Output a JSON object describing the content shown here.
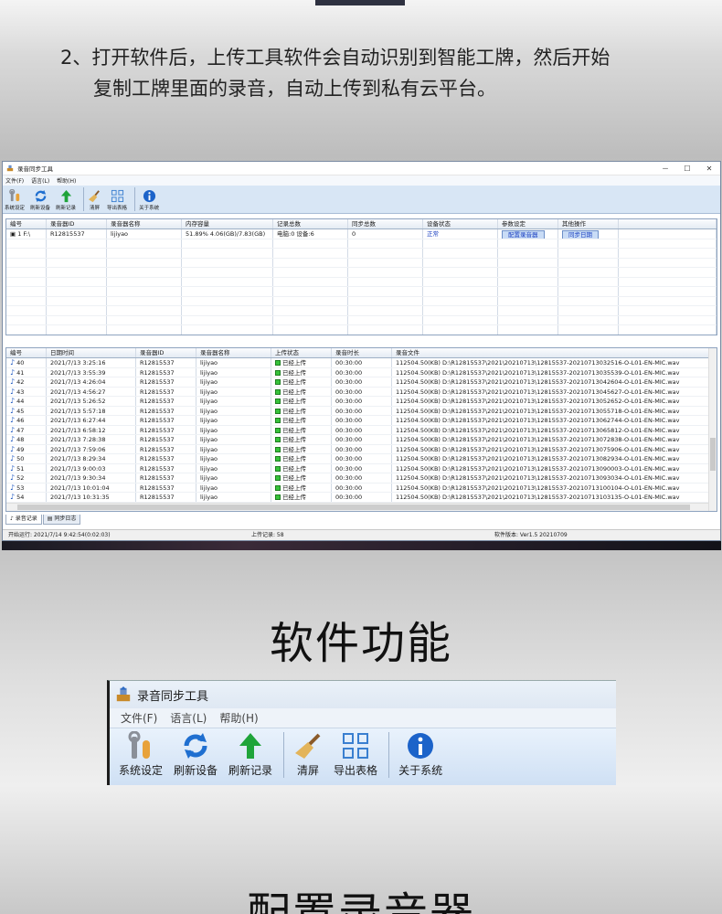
{
  "intro": {
    "line1": "2、打开软件后，上传工具软件会自动识别到智能工牌，然后开始",
    "line2": "复制工牌里面的录音，自动上传到私有云平台。"
  },
  "window": {
    "title": "录音同步工具",
    "controls": [
      "－",
      "☐",
      "✕"
    ],
    "menu": [
      "文件(F)",
      "语言(L)",
      "帮助(H)"
    ],
    "toolbar": [
      {
        "label": "系统设定",
        "icon": "wrench-settings-icon"
      },
      {
        "label": "刷新设备",
        "icon": "refresh-icon"
      },
      {
        "label": "刷新记录",
        "icon": "green-arrow-up-icon"
      },
      {
        "label": "清屏",
        "icon": "broom-icon"
      },
      {
        "label": "导出表格",
        "icon": "table-grid-icon"
      },
      {
        "label": "关于系统",
        "icon": "info-icon"
      }
    ],
    "device_table": {
      "headers": [
        "编号",
        "录音器ID",
        "录音器名称",
        "内存容量",
        "记录总数",
        "同步总数",
        "设备状态",
        "参数设定",
        "其他操作"
      ],
      "rows": [
        {
          "no": "1 F:\\",
          "id": "R12815537",
          "name": "lijiyao",
          "memory": "51.89% 4.06(GB)/7.83(GB)",
          "records": "电脑:0 设备:6",
          "synced": "0",
          "status": "正常",
          "config_btn": "配置录音器",
          "sync_btn": "同步日期"
        }
      ]
    },
    "record_table": {
      "headers": [
        "编号",
        "日期时间",
        "录音器ID",
        "录音器名称",
        "上传状态",
        "录音时长",
        "录音文件"
      ],
      "rows": [
        {
          "no": "40",
          "time": "2021/7/13 3:25:16",
          "id": "R12815537",
          "name": "lijiyao",
          "state": "已经上传",
          "dur": "00:30:00",
          "file": "112504.50(KB) D:\\R12815537\\2021\\20210713\\12815537-20210713032516-O-L01-EN-MIC.wav"
        },
        {
          "no": "41",
          "time": "2021/7/13 3:55:39",
          "id": "R12815537",
          "name": "lijiyao",
          "state": "已经上传",
          "dur": "00:30:00",
          "file": "112504.50(KB) D:\\R12815537\\2021\\20210713\\12815537-20210713035539-O-L01-EN-MIC.wav"
        },
        {
          "no": "42",
          "time": "2021/7/13 4:26:04",
          "id": "R12815537",
          "name": "lijiyao",
          "state": "已经上传",
          "dur": "00:30:00",
          "file": "112504.50(KB) D:\\R12815537\\2021\\20210713\\12815537-20210713042604-O-L01-EN-MIC.wav"
        },
        {
          "no": "43",
          "time": "2021/7/13 4:56:27",
          "id": "R12815537",
          "name": "lijiyao",
          "state": "已经上传",
          "dur": "00:30:00",
          "file": "112504.50(KB) D:\\R12815537\\2021\\20210713\\12815537-20210713045627-O-L01-EN-MIC.wav"
        },
        {
          "no": "44",
          "time": "2021/7/13 5:26:52",
          "id": "R12815537",
          "name": "lijiyao",
          "state": "已经上传",
          "dur": "00:30:00",
          "file": "112504.50(KB) D:\\R12815537\\2021\\20210713\\12815537-20210713052652-O-L01-EN-MIC.wav"
        },
        {
          "no": "45",
          "time": "2021/7/13 5:57:18",
          "id": "R12815537",
          "name": "lijiyao",
          "state": "已经上传",
          "dur": "00:30:00",
          "file": "112504.50(KB) D:\\R12815537\\2021\\20210713\\12815537-20210713055718-O-L01-EN-MIC.wav"
        },
        {
          "no": "46",
          "time": "2021/7/13 6:27:44",
          "id": "R12815537",
          "name": "lijiyao",
          "state": "已经上传",
          "dur": "00:30:00",
          "file": "112504.50(KB) D:\\R12815537\\2021\\20210713\\12815537-20210713062744-O-L01-EN-MIC.wav"
        },
        {
          "no": "47",
          "time": "2021/7/13 6:58:12",
          "id": "R12815537",
          "name": "lijiyao",
          "state": "已经上传",
          "dur": "00:30:00",
          "file": "112504.50(KB) D:\\R12815537\\2021\\20210713\\12815537-20210713065812-O-L01-EN-MIC.wav"
        },
        {
          "no": "48",
          "time": "2021/7/13 7:28:38",
          "id": "R12815537",
          "name": "lijiyao",
          "state": "已经上传",
          "dur": "00:30:00",
          "file": "112504.50(KB) D:\\R12815537\\2021\\20210713\\12815537-20210713072838-O-L01-EN-MIC.wav"
        },
        {
          "no": "49",
          "time": "2021/7/13 7:59:06",
          "id": "R12815537",
          "name": "lijiyao",
          "state": "已经上传",
          "dur": "00:30:00",
          "file": "112504.50(KB) D:\\R12815537\\2021\\20210713\\12815537-20210713075906-O-L01-EN-MIC.wav"
        },
        {
          "no": "50",
          "time": "2021/7/13 8:29:34",
          "id": "R12815537",
          "name": "lijiyao",
          "state": "已经上传",
          "dur": "00:30:00",
          "file": "112504.50(KB) D:\\R12815537\\2021\\20210713\\12815537-20210713082934-O-L01-EN-MIC.wav"
        },
        {
          "no": "51",
          "time": "2021/7/13 9:00:03",
          "id": "R12815537",
          "name": "lijiyao",
          "state": "已经上传",
          "dur": "00:30:00",
          "file": "112504.50(KB) D:\\R12815537\\2021\\20210713\\12815537-20210713090003-O-L01-EN-MIC.wav"
        },
        {
          "no": "52",
          "time": "2021/7/13 9:30:34",
          "id": "R12815537",
          "name": "lijiyao",
          "state": "已经上传",
          "dur": "00:30:00",
          "file": "112504.50(KB) D:\\R12815537\\2021\\20210713\\12815537-20210713093034-O-L01-EN-MIC.wav"
        },
        {
          "no": "53",
          "time": "2021/7/13 10:01:04",
          "id": "R12815537",
          "name": "lijiyao",
          "state": "已经上传",
          "dur": "00:30:00",
          "file": "112504.50(KB) D:\\R12815537\\2021\\20210713\\12815537-20210713100104-O-L01-EN-MIC.wav"
        },
        {
          "no": "54",
          "time": "2021/7/13 10:31:35",
          "id": "R12815537",
          "name": "lijiyao",
          "state": "已经上传",
          "dur": "00:30:00",
          "file": "112504.50(KB) D:\\R12815537\\2021\\20210713\\12815537-20210713103135-O-L01-EN-MIC.wav"
        }
      ]
    },
    "tabs": [
      "录音记录",
      "同步日志"
    ],
    "status": {
      "start": "开始运行: 2021/7/14 9:42:54(0:02:03)",
      "upload": "上传记录: 58",
      "version": "软件版本: Ver1.5 20210709"
    }
  },
  "section_title": "软件功能",
  "zoom": {
    "title": "录音同步工具",
    "menu": [
      "文件(F)",
      "语言(L)",
      "帮助(H)"
    ],
    "toolbar": [
      "系统设定",
      "刷新设备",
      "刷新记录",
      "清屏",
      "导出表格",
      "关于系统"
    ]
  },
  "bottom_title": "配置录音器"
}
